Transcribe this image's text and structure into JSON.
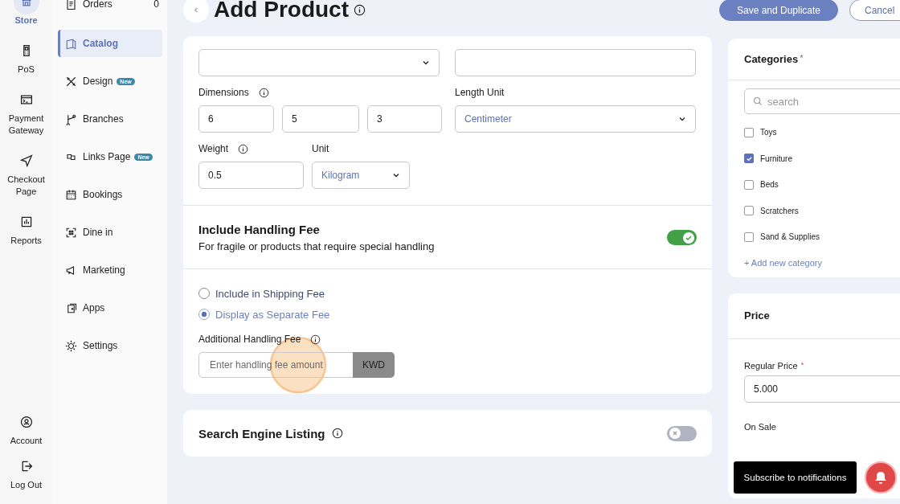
{
  "rail": {
    "items": [
      {
        "label": "Store",
        "selected": true
      },
      {
        "label": "PoS",
        "selected": false
      },
      {
        "label": "Payment Gateway",
        "selected": false
      },
      {
        "label": "Checkout Page",
        "selected": false
      },
      {
        "label": "Reports",
        "selected": false
      }
    ],
    "bottom": [
      {
        "label": "Account"
      },
      {
        "label": "Log Out"
      }
    ]
  },
  "nav": {
    "items": [
      {
        "label": "Orders",
        "count": "0",
        "selected": false
      },
      {
        "label": "Catalog",
        "selected": true
      },
      {
        "label": "Design",
        "badge": "New",
        "selected": false
      },
      {
        "label": "Branches",
        "selected": false
      },
      {
        "label": "Links Page",
        "badge": "New",
        "selected": false
      },
      {
        "label": "Bookings",
        "selected": false
      },
      {
        "label": "Dine in",
        "selected": false
      },
      {
        "label": "Marketing",
        "selected": false
      },
      {
        "label": "Apps",
        "selected": false
      },
      {
        "label": "Settings",
        "selected": false
      }
    ]
  },
  "header": {
    "title": "Add Product",
    "buttons": [
      {
        "label": "Save and Duplicate",
        "kind": "primary"
      },
      {
        "label": "Cancel",
        "kind": "outline"
      }
    ]
  },
  "shipping": {
    "dimensions": {
      "label": "Dimensions",
      "values": [
        "6",
        "5",
        "3"
      ]
    },
    "length_unit": {
      "label": "Length Unit",
      "value": "Centimeter"
    },
    "weight": {
      "label": "Weight",
      "value": "0.5"
    },
    "unit": {
      "label": "Unit",
      "value": "Kilogram"
    }
  },
  "handling_fee": {
    "title": "Include Handling Fee",
    "description": "For fragile or products that require special handling",
    "on": true,
    "options": [
      {
        "label": "Include in Shipping Fee",
        "selected": false
      },
      {
        "label": "Display as Separate Fee",
        "selected": true
      }
    ],
    "amount": {
      "label": "Additional Handling Fee",
      "placeholder": "Enter handling fee amount",
      "currency": "KWD"
    }
  },
  "seo": {
    "title": "Search Engine Listing",
    "on": false
  },
  "categories": {
    "title": "Categories",
    "required_mark": "*",
    "search_placeholder": "search",
    "items": [
      {
        "label": "Toys",
        "checked": false
      },
      {
        "label": "Furniture",
        "checked": true
      },
      {
        "label": "Beds",
        "checked": false
      },
      {
        "label": "Scratchers",
        "checked": false
      },
      {
        "label": "Sand & Supplies",
        "checked": false
      }
    ],
    "add_link": "+ Add new category"
  },
  "price": {
    "title": "Price",
    "regular_price": {
      "label": "Regular Price",
      "required_mark": "*",
      "value": "5.000"
    },
    "on_sale_label": "On Sale"
  },
  "notification": {
    "tooltip": "Subscribe to notifications"
  }
}
